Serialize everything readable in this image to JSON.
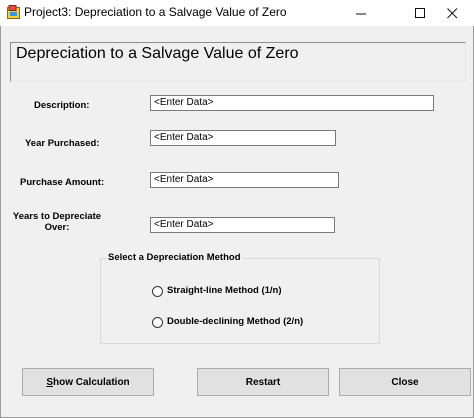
{
  "window": {
    "title": "Project3: Depreciation to a Salvage Value of Zero",
    "minimize_glyph": "—",
    "maximize_glyph": "☐",
    "close_glyph": "✕"
  },
  "header": {
    "title": "Depreciation to a Salvage Value of Zero"
  },
  "form": {
    "description_label": "Description:",
    "description_value": "<Enter Data>",
    "year_label": "Year Purchased:",
    "year_value": "<Enter Data>",
    "amount_label": "Purchase Amount:",
    "amount_value": "<Enter Data>",
    "years_label_line1": "Years to Depreciate",
    "years_label_line2": "Over:",
    "years_value": "<Enter Data>"
  },
  "method_group": {
    "legend": "Select a Depreciation Method",
    "options": [
      {
        "label": "Straight-line Method (1/n)",
        "selected": false
      },
      {
        "label": "Double-declining Method (2/n)",
        "selected": false
      }
    ]
  },
  "buttons": {
    "show_calc_first": "S",
    "show_calc_rest": "how Calculation",
    "restart": "Restart",
    "close": "Close"
  }
}
